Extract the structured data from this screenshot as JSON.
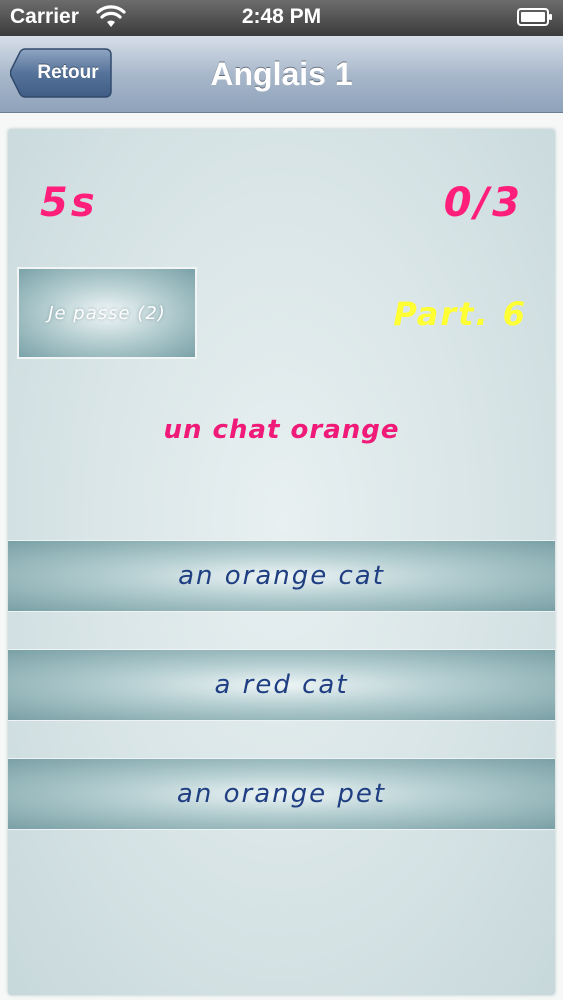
{
  "status_bar": {
    "carrier": "Carrier",
    "time": "2:48 PM",
    "wifi_icon": "wifi-icon",
    "battery_icon": "battery-icon"
  },
  "nav": {
    "back_label": "Retour",
    "title": "Anglais 1"
  },
  "quiz": {
    "timer": "5s",
    "score": "0/3",
    "skip_label": "Je passe (2)",
    "part_label": "Part. 6",
    "question": "un chat orange",
    "answers": [
      {
        "label": "an orange cat"
      },
      {
        "label": "a red cat"
      },
      {
        "label": "an orange pet"
      }
    ]
  },
  "colors": {
    "timer": "#ff1f7a",
    "score": "#ff1f7a",
    "part": "#ffff33",
    "question": "#f01a78",
    "answer_text": "#1f3f82",
    "nav_bar": "#a9b8cb"
  }
}
